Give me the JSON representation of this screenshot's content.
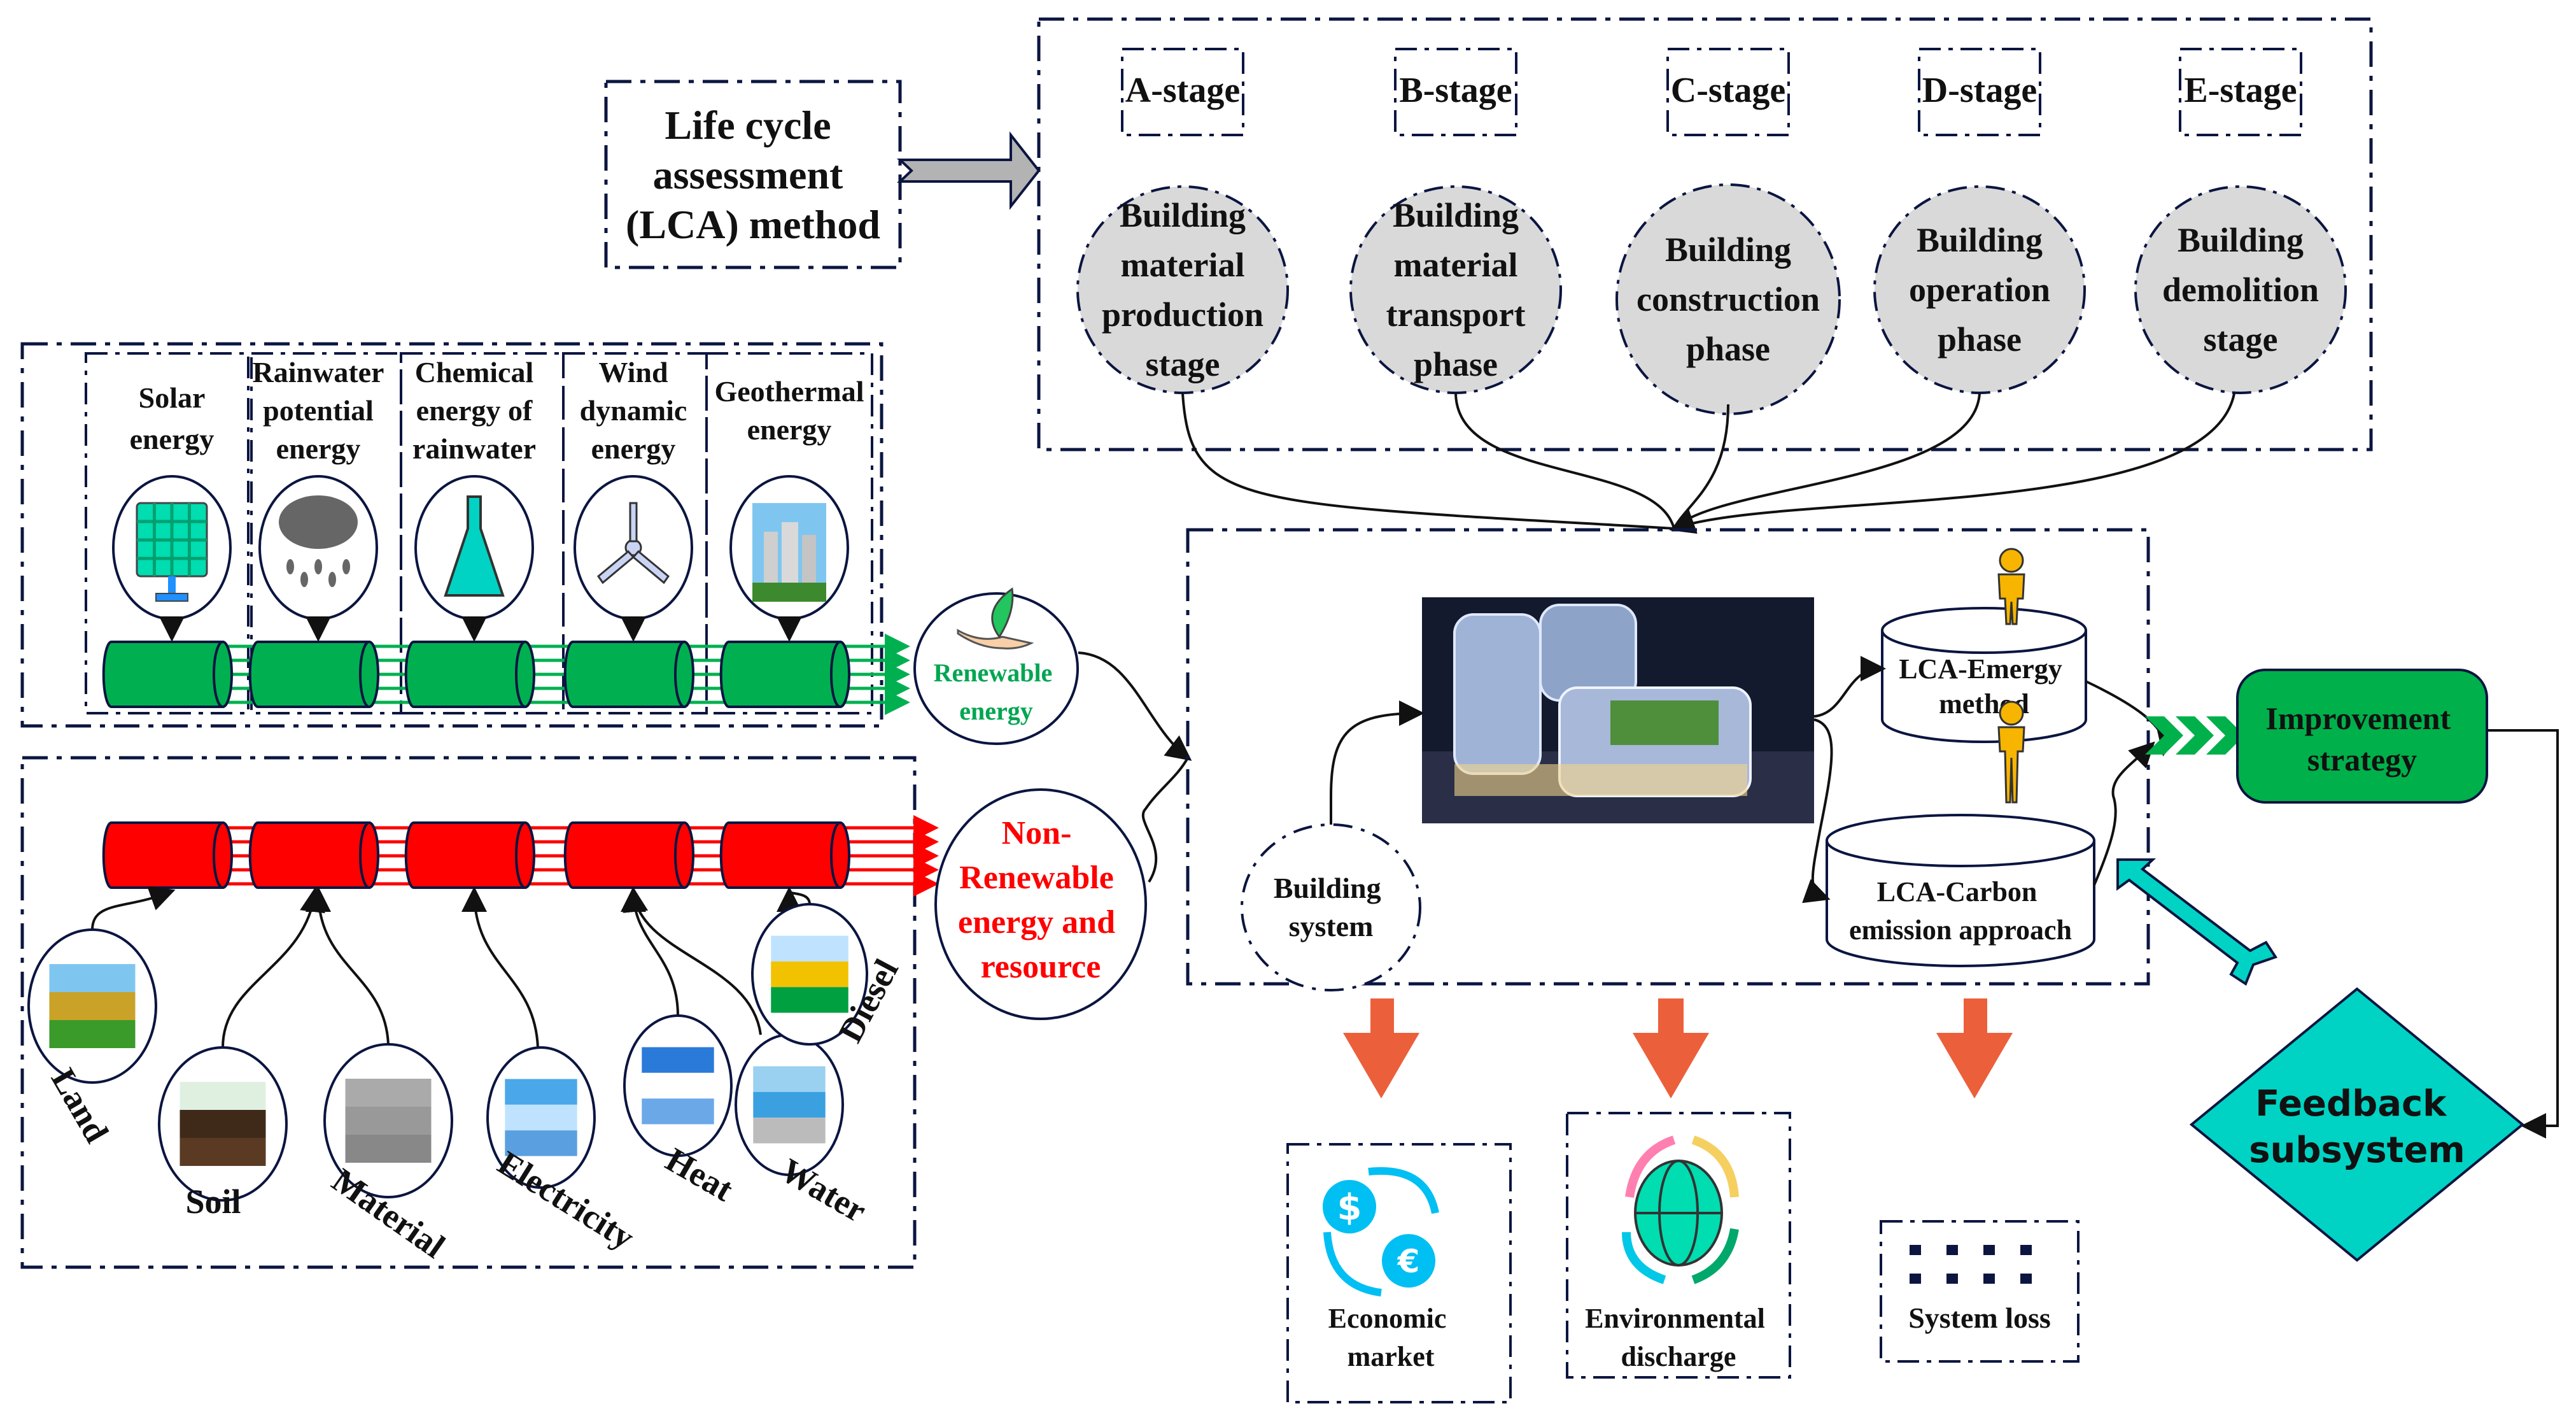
{
  "lca_method": {
    "lines": [
      "Life cycle",
      "assessment",
      "(LCA) method"
    ]
  },
  "stages": [
    {
      "code": "A-stage",
      "lines": [
        "Building",
        "material",
        "production",
        "stage"
      ]
    },
    {
      "code": "B-stage",
      "lines": [
        "Building",
        "material",
        "transport",
        "phase"
      ]
    },
    {
      "code": "C-stage",
      "lines": [
        "Building",
        "construction",
        "phase"
      ]
    },
    {
      "code": "D-stage",
      "lines": [
        "Building",
        "operation",
        "phase"
      ]
    },
    {
      "code": "E-stage",
      "lines": [
        "Building",
        "demolition",
        "stage"
      ]
    }
  ],
  "renewable_sources": [
    {
      "lines": [
        "Solar",
        "energy"
      ],
      "icon": "solar-panel-icon"
    },
    {
      "lines": [
        "Rainwater",
        "potential",
        "energy"
      ],
      "icon": "rain-cloud-icon"
    },
    {
      "lines": [
        "Chemical",
        "energy of",
        "rainwater"
      ],
      "icon": "flask-icon"
    },
    {
      "lines": [
        "Wind",
        "dynamic",
        "energy"
      ],
      "icon": "wind-turbine-icon"
    },
    {
      "lines": [
        "Geothermal",
        "energy"
      ],
      "icon": "cooling-tower-icon"
    }
  ],
  "renewable_output": {
    "lines": [
      "Renewable",
      "energy"
    ],
    "icon": "plant-in-hand-icon"
  },
  "nonrenewable_sources": [
    {
      "label": "Land",
      "icon": "land-icon"
    },
    {
      "label": "Soil",
      "icon": "soil-icon"
    },
    {
      "label": "Material",
      "icon": "bricks-icon"
    },
    {
      "label": "Electricity",
      "icon": "power-tower-icon"
    },
    {
      "label": "Heat",
      "icon": "factory-smoke-icon"
    },
    {
      "label": "Water",
      "icon": "dam-icon"
    },
    {
      "label": "Diesel",
      "icon": "fuel-nozzle-icon"
    }
  ],
  "nonrenewable_output": {
    "lines": [
      "Non-",
      "Renewable",
      "energy and",
      "resource"
    ]
  },
  "center": {
    "building_system": [
      "Building",
      "system"
    ],
    "building_image": "building-photo",
    "emergy": [
      "LCA-Emergy",
      "method"
    ],
    "carbon": [
      "LCA-Carbon",
      "emission approach"
    ]
  },
  "improvement": [
    "Improvement",
    "strategy"
  ],
  "feedback": [
    "Feedback",
    "subsystem"
  ],
  "outputs": [
    {
      "lines": [
        "Economic",
        "market"
      ],
      "icon": "currency-exchange-icon"
    },
    {
      "lines": [
        "Environmental",
        "discharge"
      ],
      "icon": "globe-cycle-icon"
    },
    {
      "lines": [
        "System loss"
      ],
      "icon": "dotted-lines-icon"
    }
  ],
  "colors": {
    "frame": "#0b1540",
    "lca_box": "#b3b3b3",
    "stage_fill": "#d9d9d9",
    "renewable_green": "#00b050",
    "renewable_text": "#00a651",
    "nonrenewable_red": "#ff0000",
    "improvement_green": "#00b04a",
    "feedback_teal": "#00d3c3",
    "output_arrow": "#ec5f3b",
    "person_yellow": "#f7b500"
  }
}
